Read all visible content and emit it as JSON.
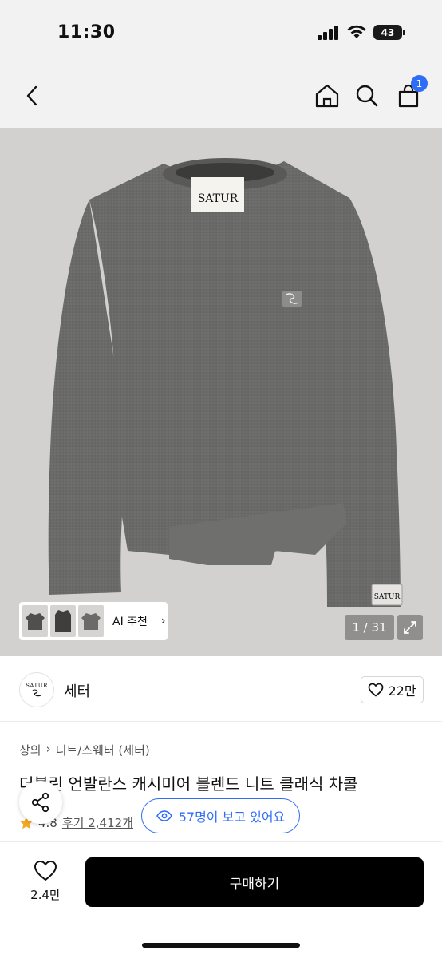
{
  "status_bar": {
    "time": "11:30",
    "battery": "43"
  },
  "nav": {
    "cart_count": "1"
  },
  "gallery": {
    "ai_label": "AI 추천",
    "ai_chevron": "›",
    "page_counter": "1 / 31",
    "garment_label": "SATUR",
    "sleeve_label": "SATUR"
  },
  "brand": {
    "logo_text": "SATUR",
    "name": "세터",
    "like_count": "22만"
  },
  "breadcrumb": {
    "level1": "상의",
    "separator": "›",
    "level2": "니트/스웨터 (세터)"
  },
  "product": {
    "title": "더블린 언발란스 캐시미어 블렌드 니트 클래식 차콜",
    "rating": "4.8",
    "reviews": "후기 2,412개",
    "viewers": "57명이 보고 있어요"
  },
  "bottom_bar": {
    "like_count": "2.4만",
    "buy_label": "구매하기"
  },
  "colors": {
    "accent": "#2f6df6",
    "buy_button": "#000000",
    "star": "#f5a623"
  }
}
